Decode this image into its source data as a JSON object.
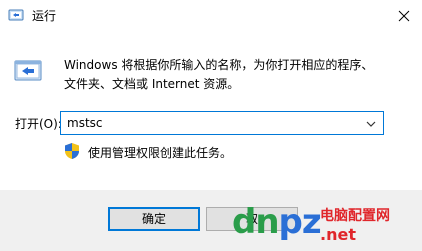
{
  "window": {
    "title": "运行",
    "close_icon": "close-icon"
  },
  "main": {
    "description_line1": "Windows 将根据你所输入的名称，为你打开相应的程序、",
    "description_line2": "文件夹、文档或 Internet 资源。",
    "open_label": "打开(O):",
    "open_value": "mstsc",
    "admin_note": "使用管理权限创建此任务。"
  },
  "footer": {
    "ok_label": "确定",
    "cancel_label": "取"
  },
  "watermark": {
    "logo_green": "dn",
    "logo_blue": "pz",
    "site_cn": "电脑配置网",
    "site_en": ".net"
  },
  "colors": {
    "accent": "#0078d7",
    "watermark_green": "#2a9d4a",
    "watermark_blue": "#2a6fd6",
    "watermark_red": "#e0262b"
  }
}
